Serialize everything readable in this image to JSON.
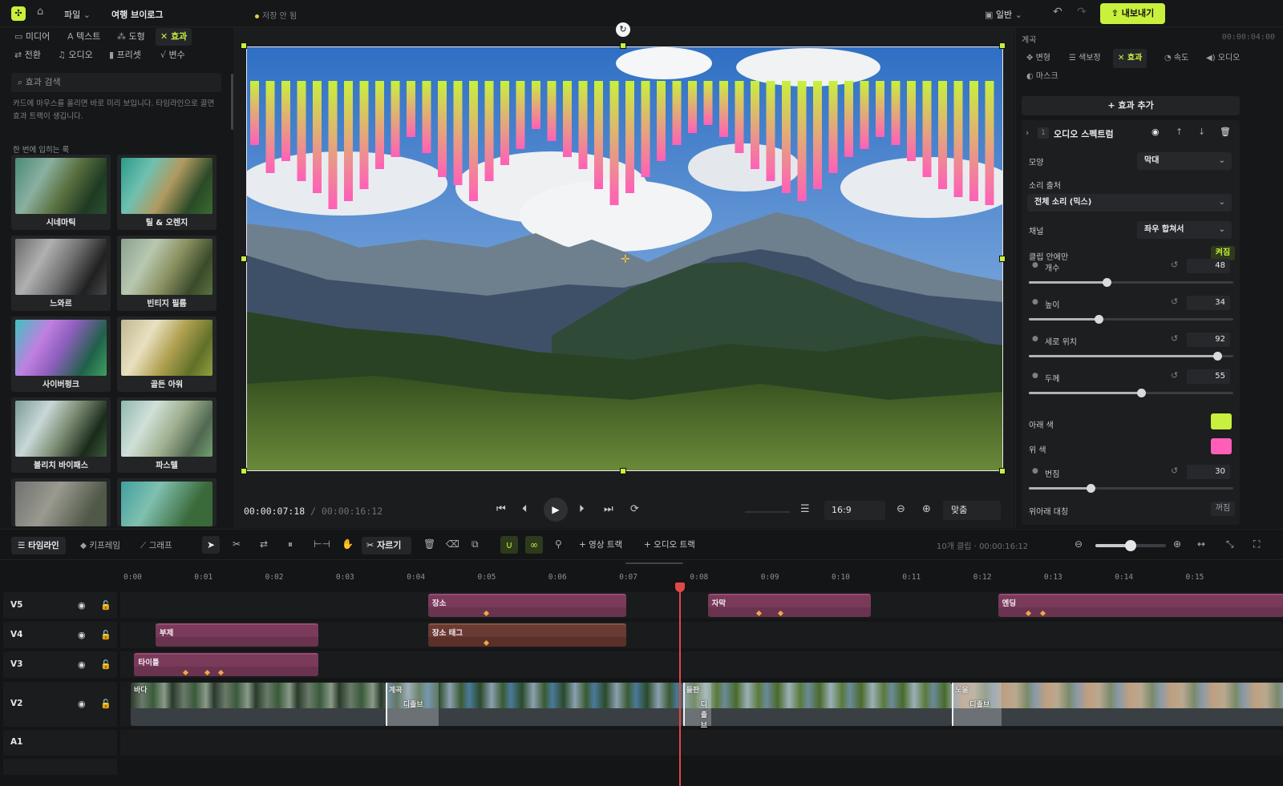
{
  "topbar": {
    "file_menu": "파일",
    "project_title": "여행 브이로그",
    "save_status": "저장 안 됨",
    "layout_label": "일반",
    "export_label": "내보내기"
  },
  "left_panel": {
    "tabs_row1": [
      "미디어",
      "텍스트",
      "도형",
      "효과"
    ],
    "tabs_row2": [
      "전환",
      "오디오",
      "프리셋",
      "변수"
    ],
    "active_tab": "효과",
    "search_placeholder": "효과 검색",
    "hint": "카드에 마우스를 올리면 바로 미리 보입니다. 타임라인으로 끌면 효과 트랙이 생깁니다.",
    "section_label": "한 번에 입히는 룩",
    "looks": [
      {
        "label": "시네마틱"
      },
      {
        "label": "틸 & 오렌지"
      },
      {
        "label": "느와르"
      },
      {
        "label": "빈티지 필름"
      },
      {
        "label": "사이버펑크"
      },
      {
        "label": "골든 아워"
      },
      {
        "label": "블리치 바이패스"
      },
      {
        "label": "파스텔"
      }
    ]
  },
  "preview": {
    "current_time": "00:00:07:18",
    "total_time": "00:00:16:12",
    "aspect_ratio": "16:9",
    "zoom_fit": "맞춤"
  },
  "right_panel": {
    "panel_label": "계곡",
    "panel_time": "00:00:04:00",
    "tabs": [
      "변형",
      "색보정",
      "효과",
      "속도",
      "오디오",
      "마스크"
    ],
    "active_tab": "효과",
    "add_effect": "효과 추가",
    "effect": {
      "index": "1",
      "name": "오디오 스펙트럼",
      "shape_label": "모양",
      "shape_value": "막대",
      "source_label": "소리 출처",
      "source_value": "전체 소리 (믹스)",
      "channel_label": "채널",
      "channel_value": "좌우 합쳐서",
      "clip_only_label": "클립 안에만",
      "clip_only_value": "켜짐",
      "sliders": [
        {
          "label": "개수",
          "value": 48,
          "fraction": 0.38
        },
        {
          "label": "높이",
          "value": 34,
          "fraction": 0.34
        },
        {
          "label": "세로 위치",
          "value": 92,
          "fraction": 0.92
        },
        {
          "label": "두께",
          "value": 55,
          "fraction": 0.55
        }
      ],
      "bottom_color_label": "아래 색",
      "bottom_color": "#c8f03c",
      "top_color_label": "위 색",
      "top_color": "#ff5fb8",
      "blur": {
        "label": "번짐",
        "value": 30,
        "fraction": 0.3
      },
      "mirror_label": "위아래 대칭",
      "mirror_value": "꺼짐"
    }
  },
  "timeline": {
    "tabs": [
      "타임라인",
      "키프레임",
      "그래프"
    ],
    "active_tab": "타임라인",
    "cut_label": "자르기",
    "add_video_track": "영상 트랙",
    "add_audio_track": "오디오 트랙",
    "clip_count": "10개 클립",
    "duration": "00:00:16:12",
    "zoom_fraction": 0.5,
    "ruler": [
      "0:00",
      "0:01",
      "0:02",
      "0:03",
      "0:04",
      "0:05",
      "0:06",
      "0:07",
      "0:08",
      "0:09",
      "0:10",
      "0:11",
      "0:12",
      "0:13",
      "0:14",
      "0:15"
    ],
    "playhead_seconds": 7.75,
    "tracks": [
      "V5",
      "V4",
      "V3",
      "V2",
      "A1"
    ],
    "clips": [
      {
        "track": "V5",
        "label": "장소",
        "start": 4.2,
        "end": 7.0,
        "kind": "title",
        "keyframes": [
          5.0
        ]
      },
      {
        "track": "V5",
        "label": "자막",
        "start": 8.15,
        "end": 10.45,
        "kind": "title",
        "keyframes": [
          8.85,
          9.15
        ]
      },
      {
        "track": "V5",
        "label": "엔딩",
        "start": 12.25,
        "end": 16.5,
        "kind": "title",
        "keyframes": [
          12.65,
          12.85
        ]
      },
      {
        "track": "V4",
        "label": "부제",
        "start": 0.35,
        "end": 2.65,
        "kind": "title",
        "keyframes": []
      },
      {
        "track": "V4",
        "label": "장소 태그",
        "start": 4.2,
        "end": 7.0,
        "kind": "tag",
        "keyframes": [
          5.0
        ]
      },
      {
        "track": "V3",
        "label": "타이틀",
        "start": 0.05,
        "end": 2.65,
        "kind": "title",
        "keyframes": [
          0.75,
          1.05,
          1.25
        ]
      }
    ],
    "video_clips": [
      {
        "label": "바다",
        "start": 0.0,
        "end": 3.6
      },
      {
        "label": "계곡",
        "start": 3.6,
        "end": 7.8
      },
      {
        "label": "들판",
        "start": 7.8,
        "end": 11.6
      },
      {
        "label": "노을",
        "start": 11.6,
        "end": 16.5
      }
    ],
    "transitions": [
      {
        "label": "디졸브",
        "start": 3.6,
        "end": 4.35
      },
      {
        "label": "디졸브",
        "start": 7.8,
        "end": 8.2
      },
      {
        "label": "디졸브",
        "start": 11.6,
        "end": 12.3
      }
    ]
  }
}
